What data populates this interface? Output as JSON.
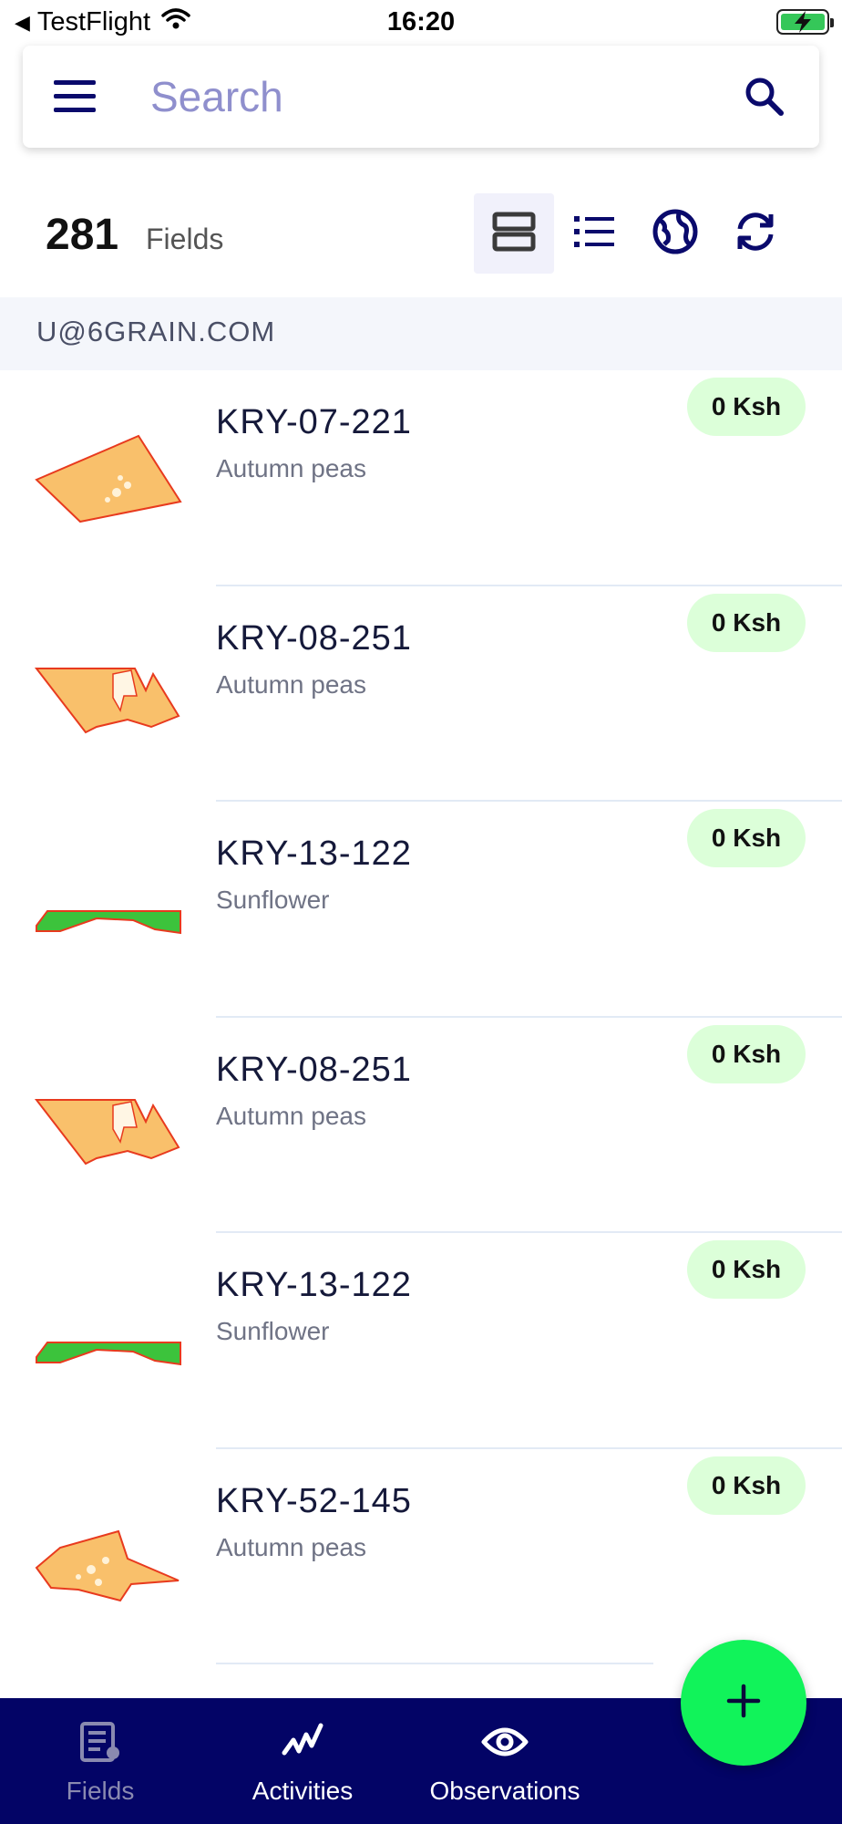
{
  "status_bar": {
    "back_app": "TestFlight",
    "time": "16:20"
  },
  "search": {
    "placeholder": "Search",
    "value": ""
  },
  "summary": {
    "count": "281",
    "count_label": "Fields"
  },
  "group": {
    "header": "U@6GRAIN.COM"
  },
  "fields": [
    {
      "name": "KRY-07-221",
      "crop": "Autumn peas",
      "price": "0 Ksh"
    },
    {
      "name": "KRY-08-251",
      "crop": "Autumn peas",
      "price": "0 Ksh"
    },
    {
      "name": "KRY-13-122",
      "crop": "Sunflower",
      "price": "0 Ksh"
    },
    {
      "name": "KRY-08-251",
      "crop": "Autumn peas",
      "price": "0 Ksh"
    },
    {
      "name": "KRY-13-122",
      "crop": "Sunflower",
      "price": "0 Ksh"
    },
    {
      "name": "KRY-52-145",
      "crop": "Autumn peas",
      "price": "0 Ksh"
    }
  ],
  "bottom_nav": {
    "fields": "Fields",
    "activities": "Activities",
    "observations": "Observations"
  },
  "colors": {
    "brand_navy": "#030466",
    "fab_green": "#11f35a",
    "price_badge": "#dcffd9",
    "field_orange": "#f9c06b",
    "field_green": "#3cc33c"
  },
  "icons": {
    "menu": "menu-icon",
    "search": "search-icon",
    "card_view": "card-view-icon",
    "list_view": "list-view-icon",
    "map_view": "globe-icon",
    "sync": "sync-icon",
    "add": "plus-icon"
  }
}
